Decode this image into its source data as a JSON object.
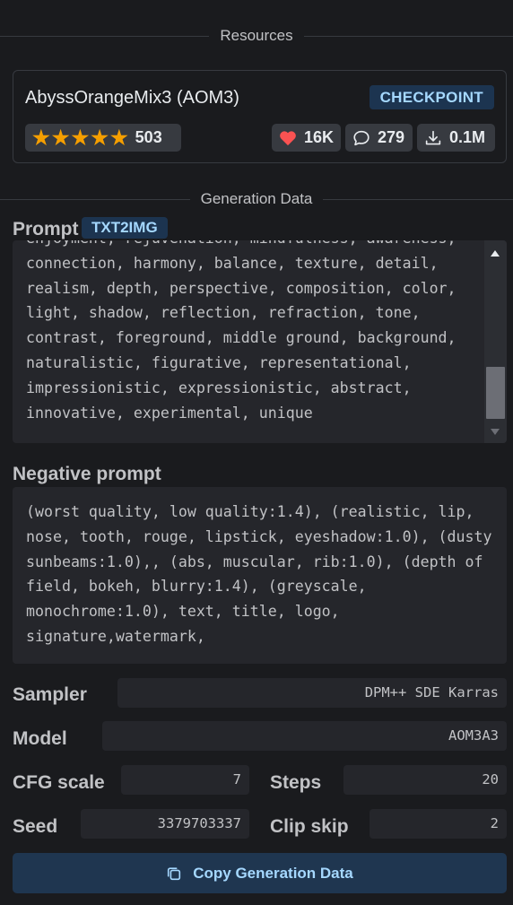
{
  "resources": {
    "heading": "Resources",
    "title": "AbyssOrangeMix3 (AOM3)",
    "type_badge": "CHECKPOINT",
    "rating_count": "503",
    "likes": "16K",
    "comments": "279",
    "downloads": "0.1M",
    "stars": 5
  },
  "generation": {
    "heading": "Generation Data",
    "prompt_label": "Prompt",
    "prompt_badge": "TXT2IMG",
    "prompt_lines": [
      "enjoyment, rejuvenation, mindfulness, awareness,",
      "connection, harmony, balance, texture, detail,",
      "realism, depth, perspective, composition, color,",
      "light, shadow, reflection, refraction, tone,",
      "contrast, foreground, middle ground, background,",
      "naturalistic, figurative, representational,",
      "impressionistic, expressionistic, abstract,",
      "innovative, experimental, unique"
    ],
    "negative_label": "Negative prompt",
    "negative_lines": [
      "(worst quality, low quality:1.4), (realistic, lip,",
      "nose, tooth, rouge, lipstick, eyeshadow:1.0), (dusty",
      "sunbeams:1.0),, (abs, muscular, rib:1.0), (depth of",
      "field, bokeh, blurry:1.4), (greyscale,",
      "monochrome:1.0), text, title, logo,",
      "signature,watermark,"
    ],
    "sampler_label": "Sampler",
    "sampler": "DPM++ SDE Karras",
    "model_label": "Model",
    "model": "AOM3A3",
    "cfg_label": "CFG scale",
    "cfg": "7",
    "steps_label": "Steps",
    "steps": "20",
    "seed_label": "Seed",
    "seed": "3379703337",
    "clip_label": "Clip skip",
    "clip": "2",
    "copy_button": "Copy Generation Data"
  },
  "colors": {
    "background": "#1a1b1e",
    "accent": "#a5d8ff",
    "star": "#f59f00",
    "heart": "#fa5252"
  }
}
